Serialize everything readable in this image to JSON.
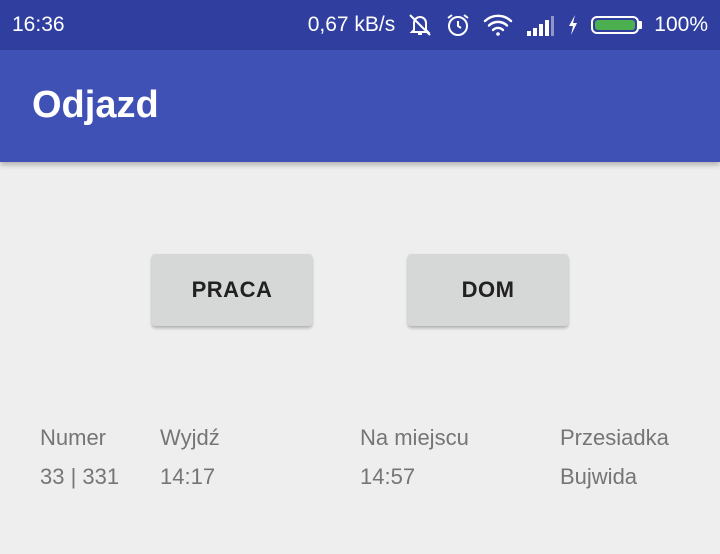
{
  "status_bar": {
    "time": "16:36",
    "speed": "0,67 kB/s",
    "battery_percent": "100%",
    "battery_level": 1.0,
    "battery_color": "#4caf50",
    "icons": [
      "vibrate-off-icon",
      "alarm-icon",
      "wifi-icon",
      "signal-icon",
      "charging-icon",
      "battery-icon"
    ]
  },
  "app_bar": {
    "title": "Odjazd",
    "color": "#3f51b5"
  },
  "buttons": {
    "praca": "PRACA",
    "dom": "DOM"
  },
  "table": {
    "headers": [
      "Numer",
      "Wyjdź",
      "Na miejscu",
      "Przesiadka"
    ],
    "rows": [
      [
        "33 | 331",
        "14:17",
        "14:57",
        "Bujwida"
      ]
    ]
  }
}
